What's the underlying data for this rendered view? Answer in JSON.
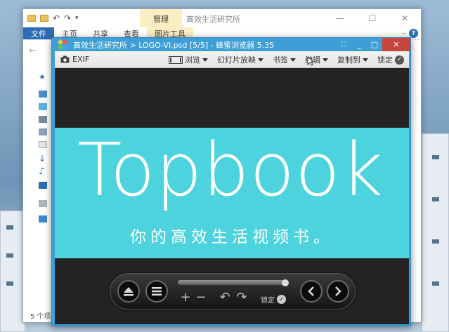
{
  "explorer": {
    "title": "高效生活研究所",
    "context_tab": "管理",
    "ribbon_tabs": [
      "文件",
      "主页",
      "共享",
      "查看",
      "图片工具"
    ],
    "status": "5 个项",
    "controls": {
      "minimize": "—",
      "maximize": "☐",
      "close": "✕"
    }
  },
  "viewer": {
    "title": "高效生活研究所 > LOGO-VI.psd [5/5] - 蜂蜜浏览器 5.35",
    "exif_label": "EXIF",
    "toolbar": {
      "browse": "浏览",
      "slideshow": "幻灯片放映",
      "bookmark": "书签",
      "edit": "编辑",
      "copy_to": "复制到",
      "lock": "锁定"
    },
    "controls": {
      "pin": "⛶",
      "minimize": "_",
      "maximize": "□",
      "close": "✕"
    },
    "image": {
      "brand": "Topbook",
      "slogan": "你的高效生活视频书。",
      "banner_color": "#4dd3dd"
    },
    "control_bar": {
      "eject_icon": "⏏",
      "menu_icon": "☰",
      "zoom_in": "+",
      "zoom_out": "−",
      "rotate_left": "↶",
      "rotate_right": "↷",
      "lock_label": "锁定",
      "prev_icon": "‹",
      "next_icon": "›"
    }
  }
}
